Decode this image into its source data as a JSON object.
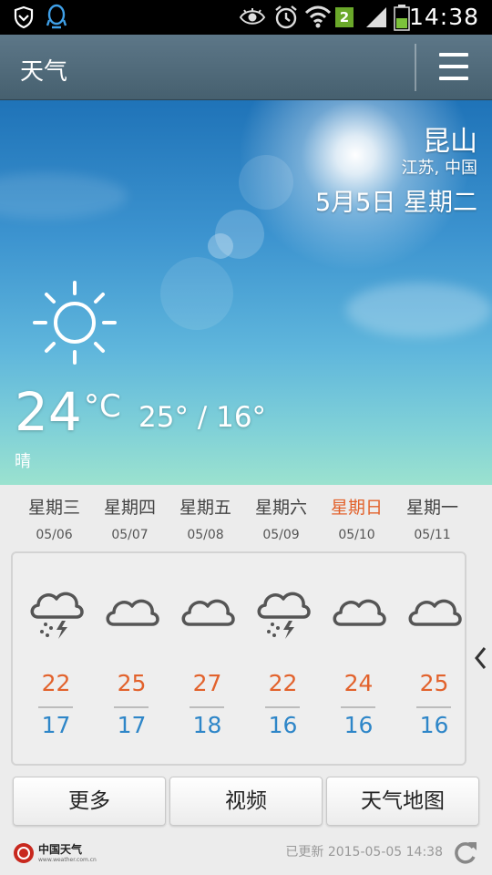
{
  "status_bar": {
    "time": "14:38",
    "badge": "2",
    "icons": [
      "shield-icon",
      "qq-icon",
      "eye-icon",
      "alarm-icon",
      "wifi-icon",
      "signal-icon",
      "battery-icon"
    ]
  },
  "app_bar": {
    "title": "天气",
    "menu_icon": "hamburger-menu-icon"
  },
  "hero": {
    "city": "昆山",
    "region": "江苏, 中国",
    "date": "5月5日 星期二",
    "current_temp": "24",
    "unit": "°C",
    "range": "25° / 16°",
    "condition": "晴",
    "condition_icon": "sun-icon"
  },
  "forecast": [
    {
      "day": "星期三",
      "date": "05/06",
      "icon": "thunder-rain-icon",
      "high": "22",
      "low": "17",
      "today": false
    },
    {
      "day": "星期四",
      "date": "05/07",
      "icon": "cloud-icon",
      "high": "25",
      "low": "17",
      "today": false
    },
    {
      "day": "星期五",
      "date": "05/08",
      "icon": "cloud-icon",
      "high": "27",
      "low": "18",
      "today": false
    },
    {
      "day": "星期六",
      "date": "05/09",
      "icon": "thunder-rain-icon",
      "high": "22",
      "low": "16",
      "today": false
    },
    {
      "day": "星期日",
      "date": "05/10",
      "icon": "cloud-icon",
      "high": "24",
      "low": "16",
      "today": true
    },
    {
      "day": "星期一",
      "date": "05/11",
      "icon": "cloud-icon",
      "high": "25",
      "low": "16",
      "today": false
    }
  ],
  "buttons": {
    "more": "更多",
    "video": "视频",
    "map": "天气地图"
  },
  "footer": {
    "logo_text": "中国天气",
    "logo_sub": "www.weather.com.cn",
    "updated": "已更新 2015-05-05 14:38"
  },
  "colors": {
    "high_temp": "#e2622c",
    "low_temp": "#2e86c8",
    "today_accent": "#e2622c",
    "app_bar": "#526c7c"
  }
}
